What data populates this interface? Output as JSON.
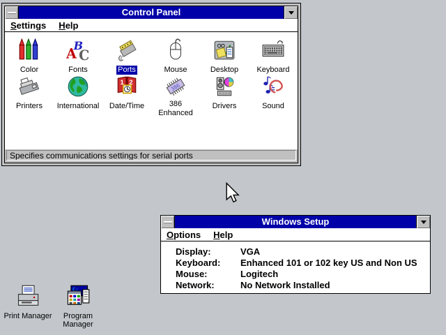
{
  "colors": {
    "desktop_background": "#c3c7cb",
    "window_face": "#c0c0c0",
    "titlebar_blue": "#0000a8",
    "selection_text": "#ffffff"
  },
  "cursor": "arrow-pointer",
  "control_panel": {
    "title": "Control Panel",
    "window_buttons": {
      "control_menu": "minus-bar",
      "minimize": "down-arrow"
    },
    "menu": [
      {
        "label": "Settings"
      },
      {
        "label": "Help"
      }
    ],
    "applets": [
      {
        "label": "Color"
      },
      {
        "label": "Fonts"
      },
      {
        "label": "Ports",
        "selected": true
      },
      {
        "label": "Mouse"
      },
      {
        "label": "Desktop"
      },
      {
        "label": "Keyboard"
      },
      {
        "label": "Printers"
      },
      {
        "label": "International"
      },
      {
        "label": "Date/Time"
      },
      {
        "label": "386 Enhanced"
      },
      {
        "label": "Drivers"
      },
      {
        "label": "Sound"
      }
    ],
    "status_text": "Specifies communications settings for serial ports"
  },
  "windows_setup": {
    "title": "Windows Setup",
    "window_buttons": {
      "control_menu": "minus-bar",
      "minimize": "down-arrow"
    },
    "menu": [
      {
        "label": "Options"
      },
      {
        "label": "Help"
      }
    ],
    "settings": [
      {
        "label": "Display:",
        "value": "VGA"
      },
      {
        "label": "Keyboard:",
        "value": "Enhanced 101 or 102 key US and Non US"
      },
      {
        "label": "Mouse:",
        "value": "Logitech"
      },
      {
        "label": "Network:",
        "value": "No Network Installed"
      }
    ]
  },
  "desktop_icons": [
    {
      "label": "Print Manager"
    },
    {
      "label": "Program Manager"
    }
  ]
}
